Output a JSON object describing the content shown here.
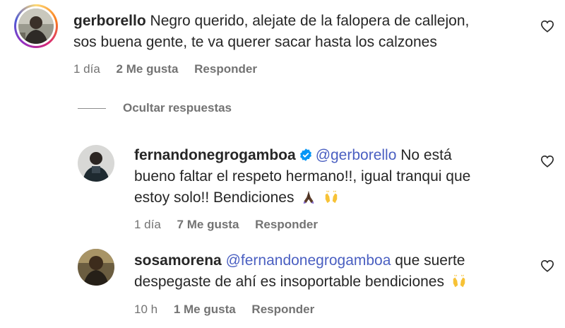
{
  "comments": [
    {
      "username": "gerborello",
      "text_line1": "Negro querido, alejate de la falopera de callejon,",
      "text_line2": "sos buena gente, te va querer sacar hasta los calzones",
      "time": "1 día",
      "likes": "2 Me gusta",
      "reply": "Responder"
    }
  ],
  "hide_replies_label": "Ocultar respuestas",
  "replies": [
    {
      "username": "fernandonegrogamboa",
      "verified": true,
      "mention": "@gerborello",
      "text_part1": "No está",
      "text_line2": "bueno faltar el respeto hermano!!, igual tranqui que",
      "text_line3": "estoy solo!! Bendiciones",
      "emojis": [
        "praying-hands-icon",
        "raising-hands-icon"
      ],
      "time": "1 día",
      "likes": "7 Me gusta",
      "reply": "Responder"
    },
    {
      "username": "sosamorena",
      "mention": "@fernandonegrogamboa",
      "text_part1": "que suerte",
      "text_line2": "despegaste de ahí es insoportable bendiciones",
      "emojis": [
        "raising-hands-icon"
      ],
      "time": "10 h",
      "likes": "1 Me gusta",
      "reply": "Responder"
    }
  ],
  "colors": {
    "text": "#262626",
    "muted": "#737373",
    "mention": "#4a5fc1",
    "verified": "#0095f6"
  }
}
